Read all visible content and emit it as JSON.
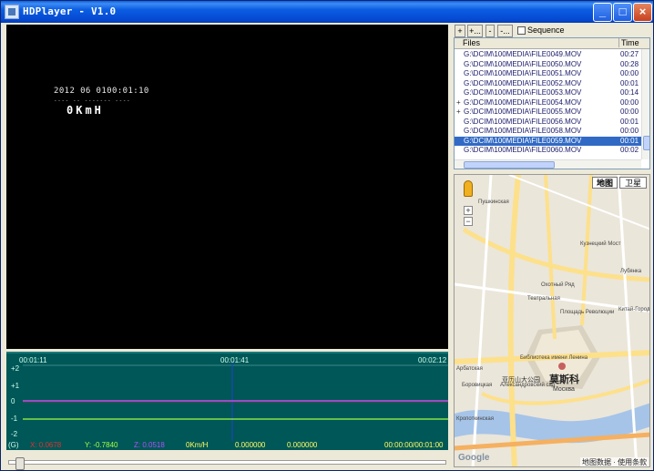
{
  "window": {
    "title": "HDPlayer - V1.0",
    "minimize": "_",
    "maximize": "□",
    "close": "×"
  },
  "video": {
    "osd_datetime": "2012 06 0100:01:10",
    "osd_dash": "---- -- ------- ----",
    "osd_speed": "0KmH"
  },
  "graph": {
    "time_left": "00:01:11",
    "time_mid": "00:01:41",
    "time_right": "00:02:12",
    "y_labels": [
      "+2",
      "+1",
      "0",
      "-1",
      "-2"
    ],
    "status": {
      "g": "(G)",
      "x": "X: 0.0678",
      "y": "Y: -0.7840",
      "z": "Z: 0.0518",
      "speed": "0Km/H",
      "lat": "0.000000",
      "lon": "0.000000",
      "position": "00:00:00/00:01:00"
    },
    "colors": {
      "x": "#e03030",
      "y": "#a0ff40",
      "z": "#b050ff"
    }
  },
  "toolbar": {
    "add": "+",
    "add_multi": "+...",
    "remove": "-",
    "remove_multi": "-...",
    "sequence_label": "Sequence"
  },
  "files": {
    "header_files": "Files",
    "header_time": "Time",
    "rows": [
      {
        "mark": "",
        "name": "G:\\DCIM\\100MEDIA\\FILE0049.MOV",
        "time": "00:27",
        "selected": false
      },
      {
        "mark": "",
        "name": "G:\\DCIM\\100MEDIA\\FILE0050.MOV",
        "time": "00:28",
        "selected": false
      },
      {
        "mark": "",
        "name": "G:\\DCIM\\100MEDIA\\FILE0051.MOV",
        "time": "00:00",
        "selected": false
      },
      {
        "mark": "",
        "name": "G:\\DCIM\\100MEDIA\\FILE0052.MOV",
        "time": "00:01",
        "selected": false
      },
      {
        "mark": "",
        "name": "G:\\DCIM\\100MEDIA\\FILE0053.MOV",
        "time": "00:14",
        "selected": false
      },
      {
        "mark": "+",
        "name": "G:\\DCIM\\100MEDIA\\FILE0054.MOV",
        "time": "00:00",
        "selected": false
      },
      {
        "mark": "+",
        "name": "G:\\DCIM\\100MEDIA\\FILE0055.MOV",
        "time": "00:00",
        "selected": false
      },
      {
        "mark": "",
        "name": "G:\\DCIM\\100MEDIA\\FILE0056.MOV",
        "time": "00:01",
        "selected": false
      },
      {
        "mark": "",
        "name": "G:\\DCIM\\100MEDIA\\FILE0058.MOV",
        "time": "00:00",
        "selected": false
      },
      {
        "mark": "",
        "name": "G:\\DCIM\\100MEDIA\\FILE0059.MOV",
        "time": "00:01",
        "selected": true
      },
      {
        "mark": "",
        "name": "G:\\DCIM\\100MEDIA\\FILE0060.MOV",
        "time": "00:02",
        "selected": false
      }
    ]
  },
  "map": {
    "tab_map": "地图",
    "tab_satellite": "卫星",
    "zoom_in": "+",
    "zoom_out": "−",
    "labels": {
      "pushkinskaya": "Пушкинская",
      "kuznetsky": "Кузнецкий Мост",
      "lubyanka": "Лубянка",
      "teatralnaya": "Театральная",
      "revolutsii": "Площадь Революции",
      "kitay": "Китай-Город",
      "biblioteka": "Библиотека имени Ленина",
      "alexandrovsky": "Александровский сад",
      "borovitskaya": "Боровицкая",
      "arbatskaya": "Арбатская",
      "kropotkinskaya": "Кропоткинская",
      "moscow_cn": "莫斯科",
      "moscow_ru": "Москва",
      "kremlin_cn": "亚历山大公园",
      "okhotny": "Охотный Ряд"
    },
    "google": "Google",
    "footer": "地图数据 · 使用条款"
  }
}
